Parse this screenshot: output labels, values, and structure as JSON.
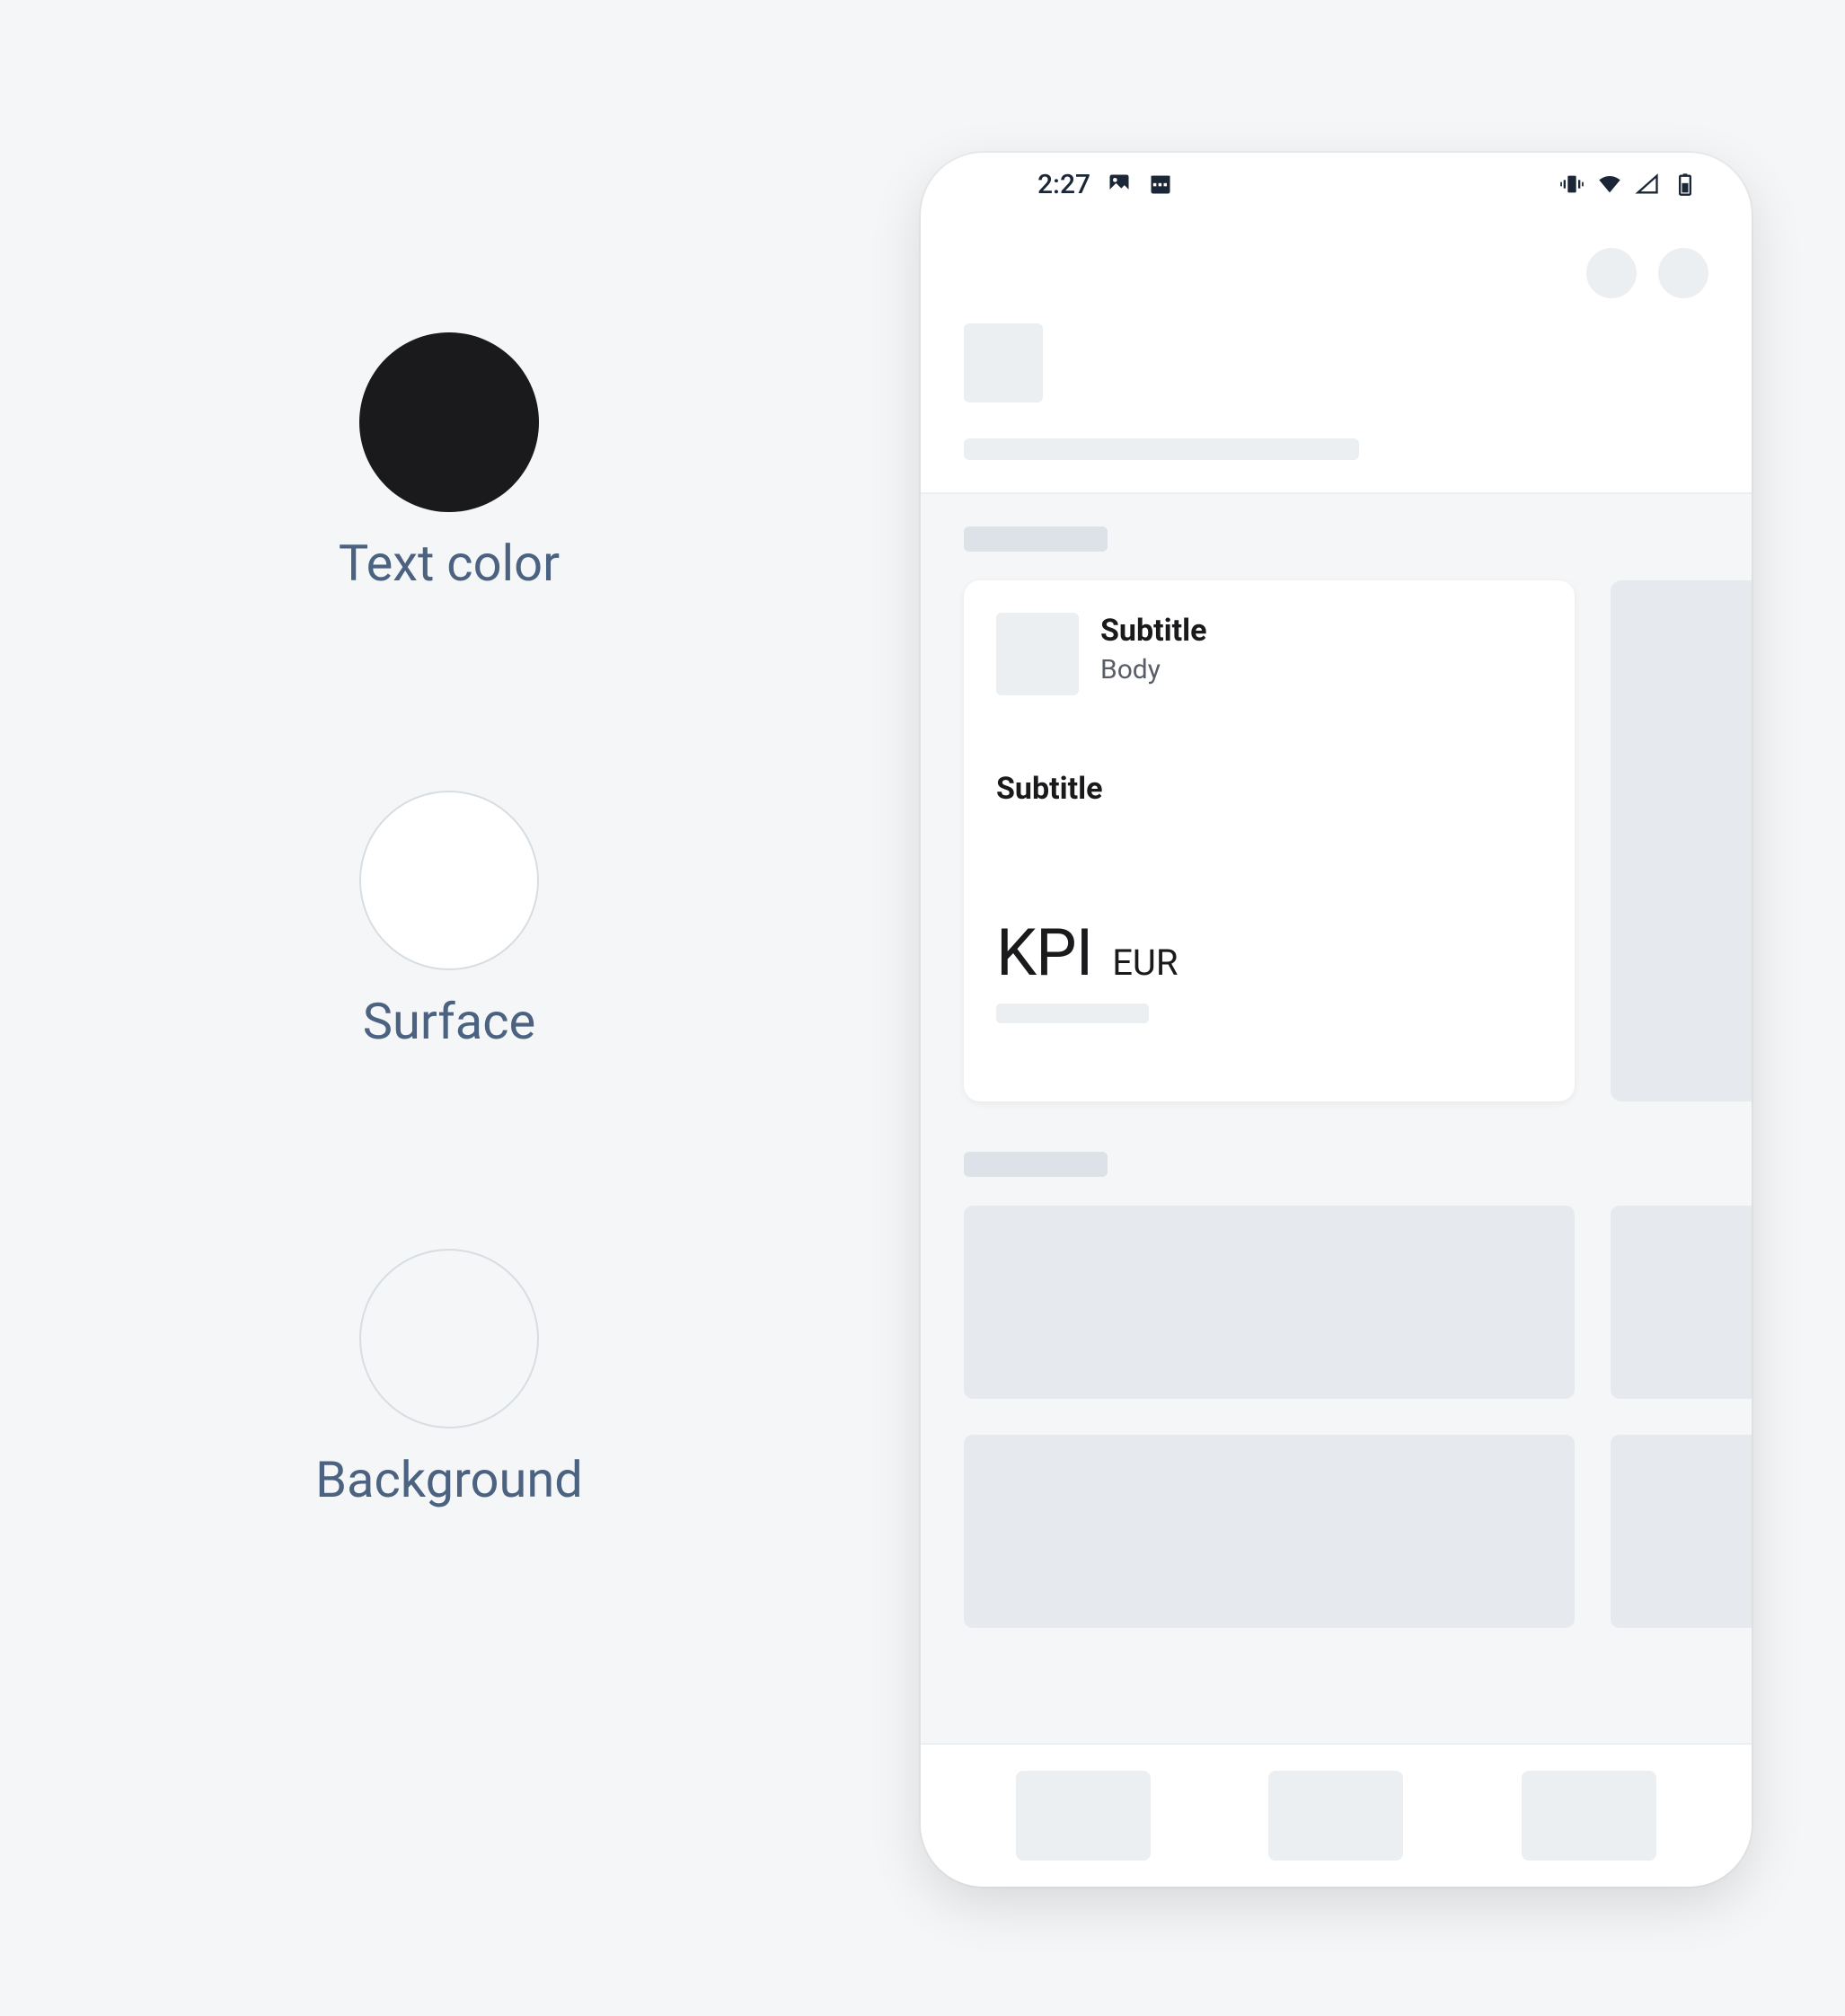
{
  "swatches": {
    "text_color": {
      "label": "Text color",
      "hex": "#1a191b"
    },
    "surface": {
      "label": "Surface",
      "hex": "#ffffff"
    },
    "background": {
      "label": "Background",
      "hex": "#f5f6f7"
    }
  },
  "status": {
    "time": "2:27",
    "icons_left": [
      "image-icon",
      "calendar-icon"
    ],
    "icons_right": [
      "vibrate-icon",
      "wifi-icon",
      "signal-icon",
      "battery-icon"
    ]
  },
  "card": {
    "subtitle1": "Subtitle",
    "body": "Body",
    "subtitle2": "Subtitle",
    "kpi": "KPI",
    "kpi_unit": "EUR"
  }
}
